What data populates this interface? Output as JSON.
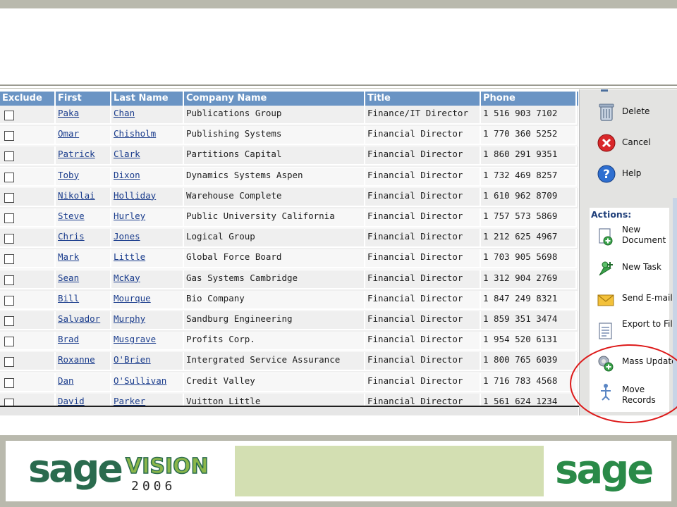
{
  "grid": {
    "headers": {
      "exclude": "Exclude",
      "first": "First",
      "last": "Last Name",
      "company": "Company Name",
      "title": "Title",
      "phone": "Phone"
    },
    "rows": [
      {
        "first": "Paka",
        "last": "Chan",
        "company": "Publications Group",
        "title": "Finance/IT Director",
        "phone": "1 516 903 7102"
      },
      {
        "first": "Omar",
        "last": "Chisholm",
        "company": "Publishing Systems",
        "title": "Financial Director",
        "phone": "1 770 360 5252"
      },
      {
        "first": "Patrick",
        "last": "Clark",
        "company": "Partitions Capital",
        "title": "Financial Director",
        "phone": "1 860 291 9351"
      },
      {
        "first": "Toby",
        "last": "Dixon",
        "company": "Dynamics Systems Aspen",
        "title": "Financial Director",
        "phone": "1 732 469 8257"
      },
      {
        "first": "Nikolai",
        "last": "Holliday",
        "company": "Warehouse Complete",
        "title": "Financial Director",
        "phone": "1 610 962 8709"
      },
      {
        "first": "Steve",
        "last": "Hurley",
        "company": "Public University California",
        "title": "Financial Director",
        "phone": "1 757 573 5869"
      },
      {
        "first": "Chris",
        "last": "Jones",
        "company": "Logical Group",
        "title": "Financial Director",
        "phone": "1 212 625 4967"
      },
      {
        "first": "Mark",
        "last": "Little",
        "company": "Global Force Board",
        "title": "Financial Director",
        "phone": "1 703 905 5698"
      },
      {
        "first": "Sean",
        "last": "McKay",
        "company": "Gas Systems Cambridge",
        "title": "Financial Director",
        "phone": "1 312 904 2769"
      },
      {
        "first": "Bill",
        "last": "Mourque",
        "company": "Bio Company",
        "title": "Financial Director",
        "phone": "1 847 249 8321"
      },
      {
        "first": "Salvador",
        "last": "Murphy",
        "company": "Sandburg Engineering",
        "title": "Financial Director",
        "phone": "1 859 351 3474"
      },
      {
        "first": "Brad",
        "last": "Musgrave",
        "company": "Profits Corp.",
        "title": "Financial Director",
        "phone": "1 954 520 6131"
      },
      {
        "first": "Roxanne",
        "last": "O'Brien",
        "company": "Intergrated Service Assurance",
        "title": "Financial Director",
        "phone": "1 800 765 6039"
      },
      {
        "first": "Dan",
        "last": "O'Sullivan",
        "company": "Credit Valley",
        "title": "Financial Director",
        "phone": "1 716 783 4568"
      },
      {
        "first": "David",
        "last": "Parker",
        "company": "Vuitton Little",
        "title": "Financial Director",
        "phone": "1 561 624 1234"
      }
    ]
  },
  "panel": {
    "delete_label": "Delete",
    "cancel_label": "Cancel",
    "help_label": "Help",
    "actions_label": "Actions:",
    "actions": [
      {
        "label": "New Document",
        "icon": "new-document-icon"
      },
      {
        "label": "New Task",
        "icon": "new-task-icon"
      },
      {
        "label": "Send E-mail",
        "icon": "envelope-icon"
      },
      {
        "label": "Export to File",
        "icon": "export-file-icon"
      },
      {
        "label": "Mass Update",
        "icon": "mass-update-icon"
      },
      {
        "label": "Move Records",
        "icon": "move-records-icon"
      }
    ]
  },
  "footer": {
    "logo_left_word": "sage",
    "logo_left_vision": "VISION",
    "logo_left_year": "2006",
    "logo_right_word": "sage"
  },
  "colors": {
    "header_blue": "#6a94c4",
    "link_blue": "#1a3c8c",
    "highlight_red": "#dd1a1a",
    "sage_green": "#2a6b4e",
    "footer_green_box": "#d3dfb2"
  }
}
